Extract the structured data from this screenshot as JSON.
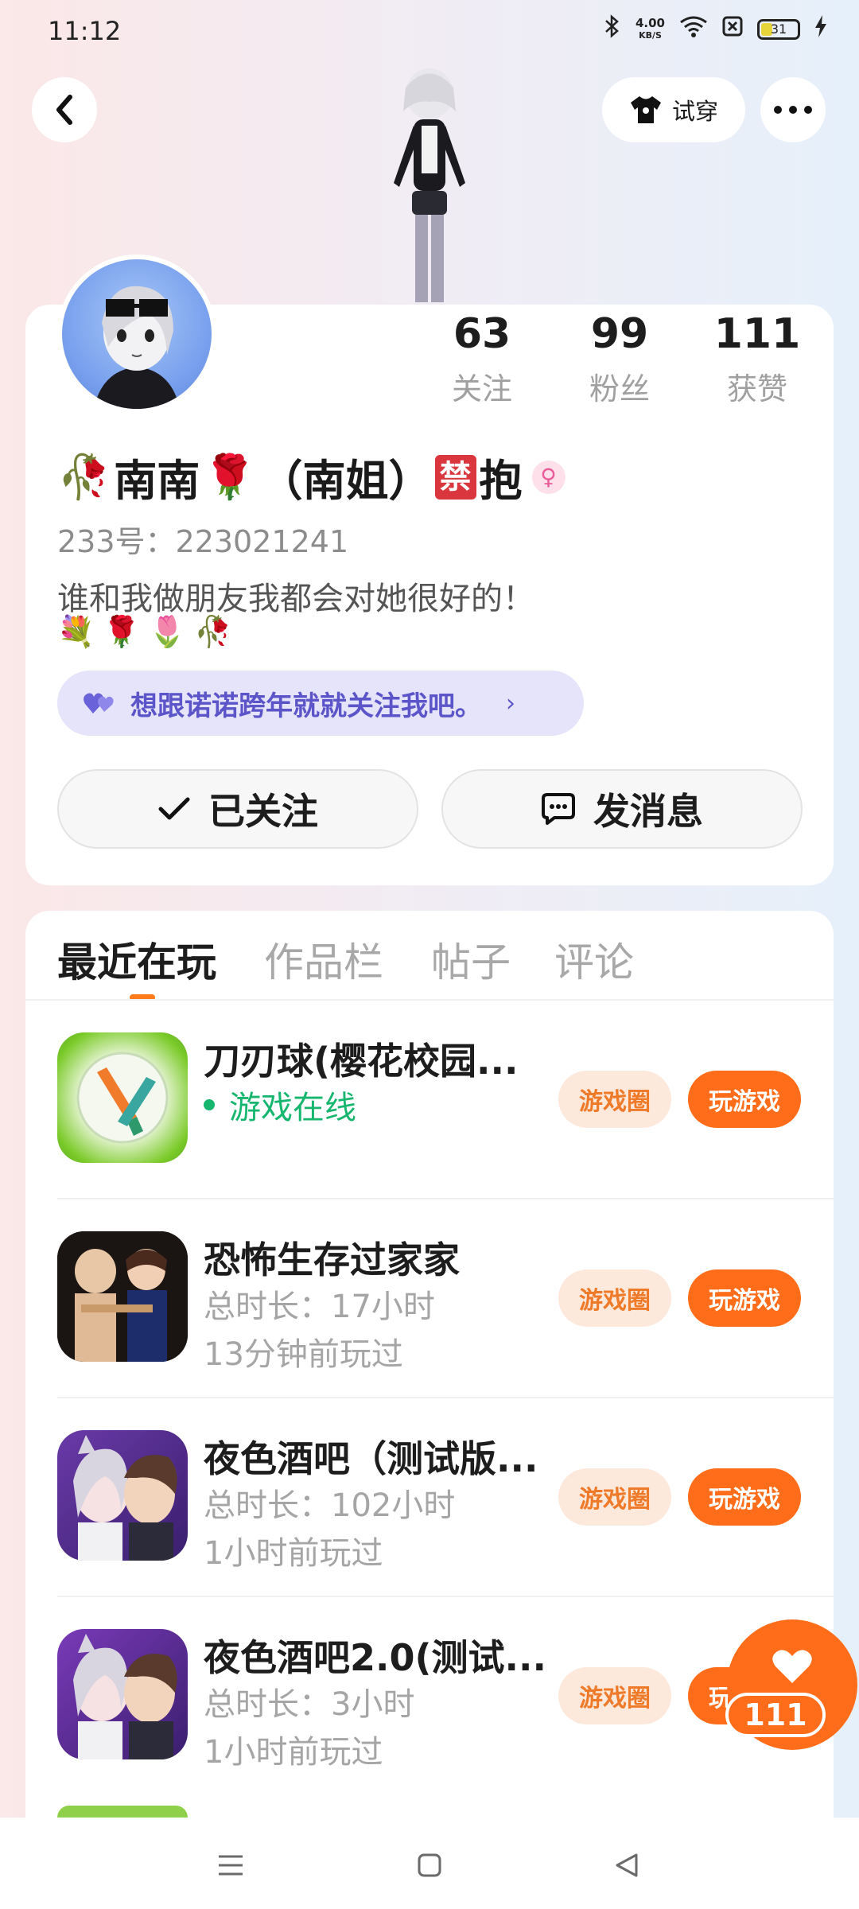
{
  "status_bar": {
    "time": "11:12",
    "net_speed_value": "4.00",
    "net_speed_unit": "KB/S",
    "battery": "31"
  },
  "header": {
    "tryon_label": "试穿"
  },
  "profile": {
    "stats": [
      {
        "value": "63",
        "label": "关注"
      },
      {
        "value": "99",
        "label": "粉丝"
      },
      {
        "value": "111",
        "label": "获赞"
      }
    ],
    "name_emoji_left": "🥀",
    "name": "南南",
    "name_emoji_rose": "🌹",
    "name_suffix": "（南姐）",
    "ban_badge": "禁",
    "name_tail": "抱",
    "gender_symbol": "♀",
    "uid": "233号：223021241",
    "bio": "谁和我做朋友我都会对她很好的！",
    "bio_emojis": [
      "💐",
      "🌹",
      "🌷",
      "🥀"
    ],
    "promo_text": "想跟诺诺跨年就就关注我吧。",
    "follow_label": "已关注",
    "message_label": "发消息"
  },
  "tabs": [
    {
      "label": "最近在玩",
      "active": true
    },
    {
      "label": "作品栏",
      "active": false
    },
    {
      "label": "帖子",
      "active": false
    },
    {
      "label": "评论",
      "active": false
    }
  ],
  "games": [
    {
      "title": "刀刃球(樱花校园...",
      "status": "游戏在线",
      "circle_label": "游戏圈",
      "play_label": "玩游戏"
    },
    {
      "title": "恐怖生存过家家",
      "duration": "总时长：17小时",
      "last_played": "13分钟前玩过",
      "circle_label": "游戏圈",
      "play_label": "玩游戏"
    },
    {
      "title": "夜色酒吧（测试版...",
      "duration": "总时长：102小时",
      "last_played": "1小时前玩过",
      "circle_label": "游戏圈",
      "play_label": "玩游戏"
    },
    {
      "title": "夜色酒吧2.0(测试...",
      "duration": "总时长：3小时",
      "last_played": "1小时前玩过",
      "circle_label": "游戏圈",
      "play_label": "玩"
    }
  ],
  "like_fab": {
    "count": "111"
  },
  "colors": {
    "accent": "#ff6d1a",
    "online": "#17b66f",
    "promo_bg": "#e6e4fb",
    "promo_text": "#5b55c9"
  }
}
